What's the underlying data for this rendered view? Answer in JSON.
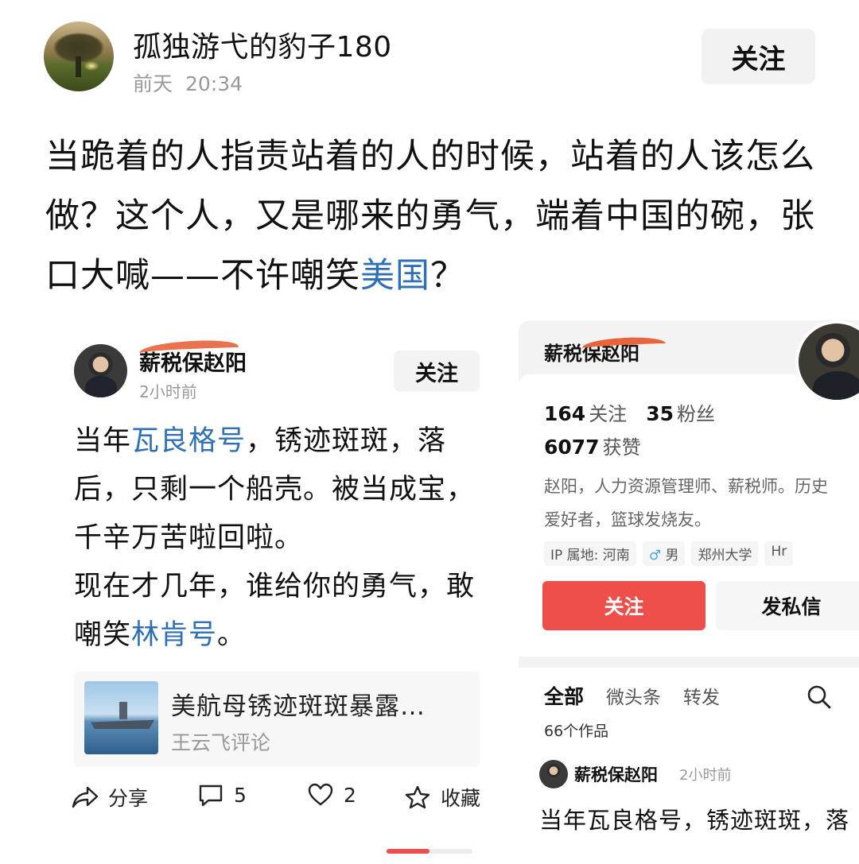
{
  "post": {
    "author": "孤独游弋的豹子180",
    "time_day": "前天",
    "time_clock": "20:34",
    "follow_label": "关注",
    "body_part1": "当跪着的人指责站着的人的时候，站着的人该怎么做？这个人，又是哪来的勇气，端着中国的碗，张口大喊——不许嘲笑",
    "body_link": "美国",
    "body_end": "？"
  },
  "left_card": {
    "name": "薪税保赵阳",
    "time": "2小时前",
    "follow_label": "关注",
    "text": {
      "p1": "当年",
      "link1": "瓦良格号",
      "p2": "，锈迹斑斑，落后，只剩一个船壳。被当成宝，千辛万苦啦回啦。",
      "p3": "现在才几年，谁给你的勇气，敢嘲笑",
      "link2": "林肯号",
      "p4": "。"
    },
    "article": {
      "title": "美航母锈迹斑斑暴露…",
      "source": "王云飞评论"
    },
    "actions": {
      "share": "分享",
      "comments": "5",
      "likes": "2",
      "favorite": "收藏"
    }
  },
  "right_card": {
    "name": "薪税保赵阳",
    "following_count": "164",
    "following_label": "关注",
    "fans_count": "35",
    "fans_label": "粉丝",
    "likes_count": "6077",
    "likes_label": "获赞",
    "bio_line1": "赵阳，人力资源管理师、薪税师。历史",
    "bio_line2": "爱好者，篮球发烧友。",
    "tags": {
      "ip": "IP 属地: 河南",
      "gender": "男",
      "school": "郑州大学",
      "job": "Hr"
    },
    "follow_btn": "关注",
    "message_btn": "发私信",
    "tabs": {
      "all": "全部",
      "micro": "微头条",
      "repost": "转发"
    },
    "works_count": "66个作品",
    "post_name": "薪税保赵阳",
    "post_time": "2小时前",
    "post_text": "当年瓦良格号，锈迹斑斑，落"
  }
}
